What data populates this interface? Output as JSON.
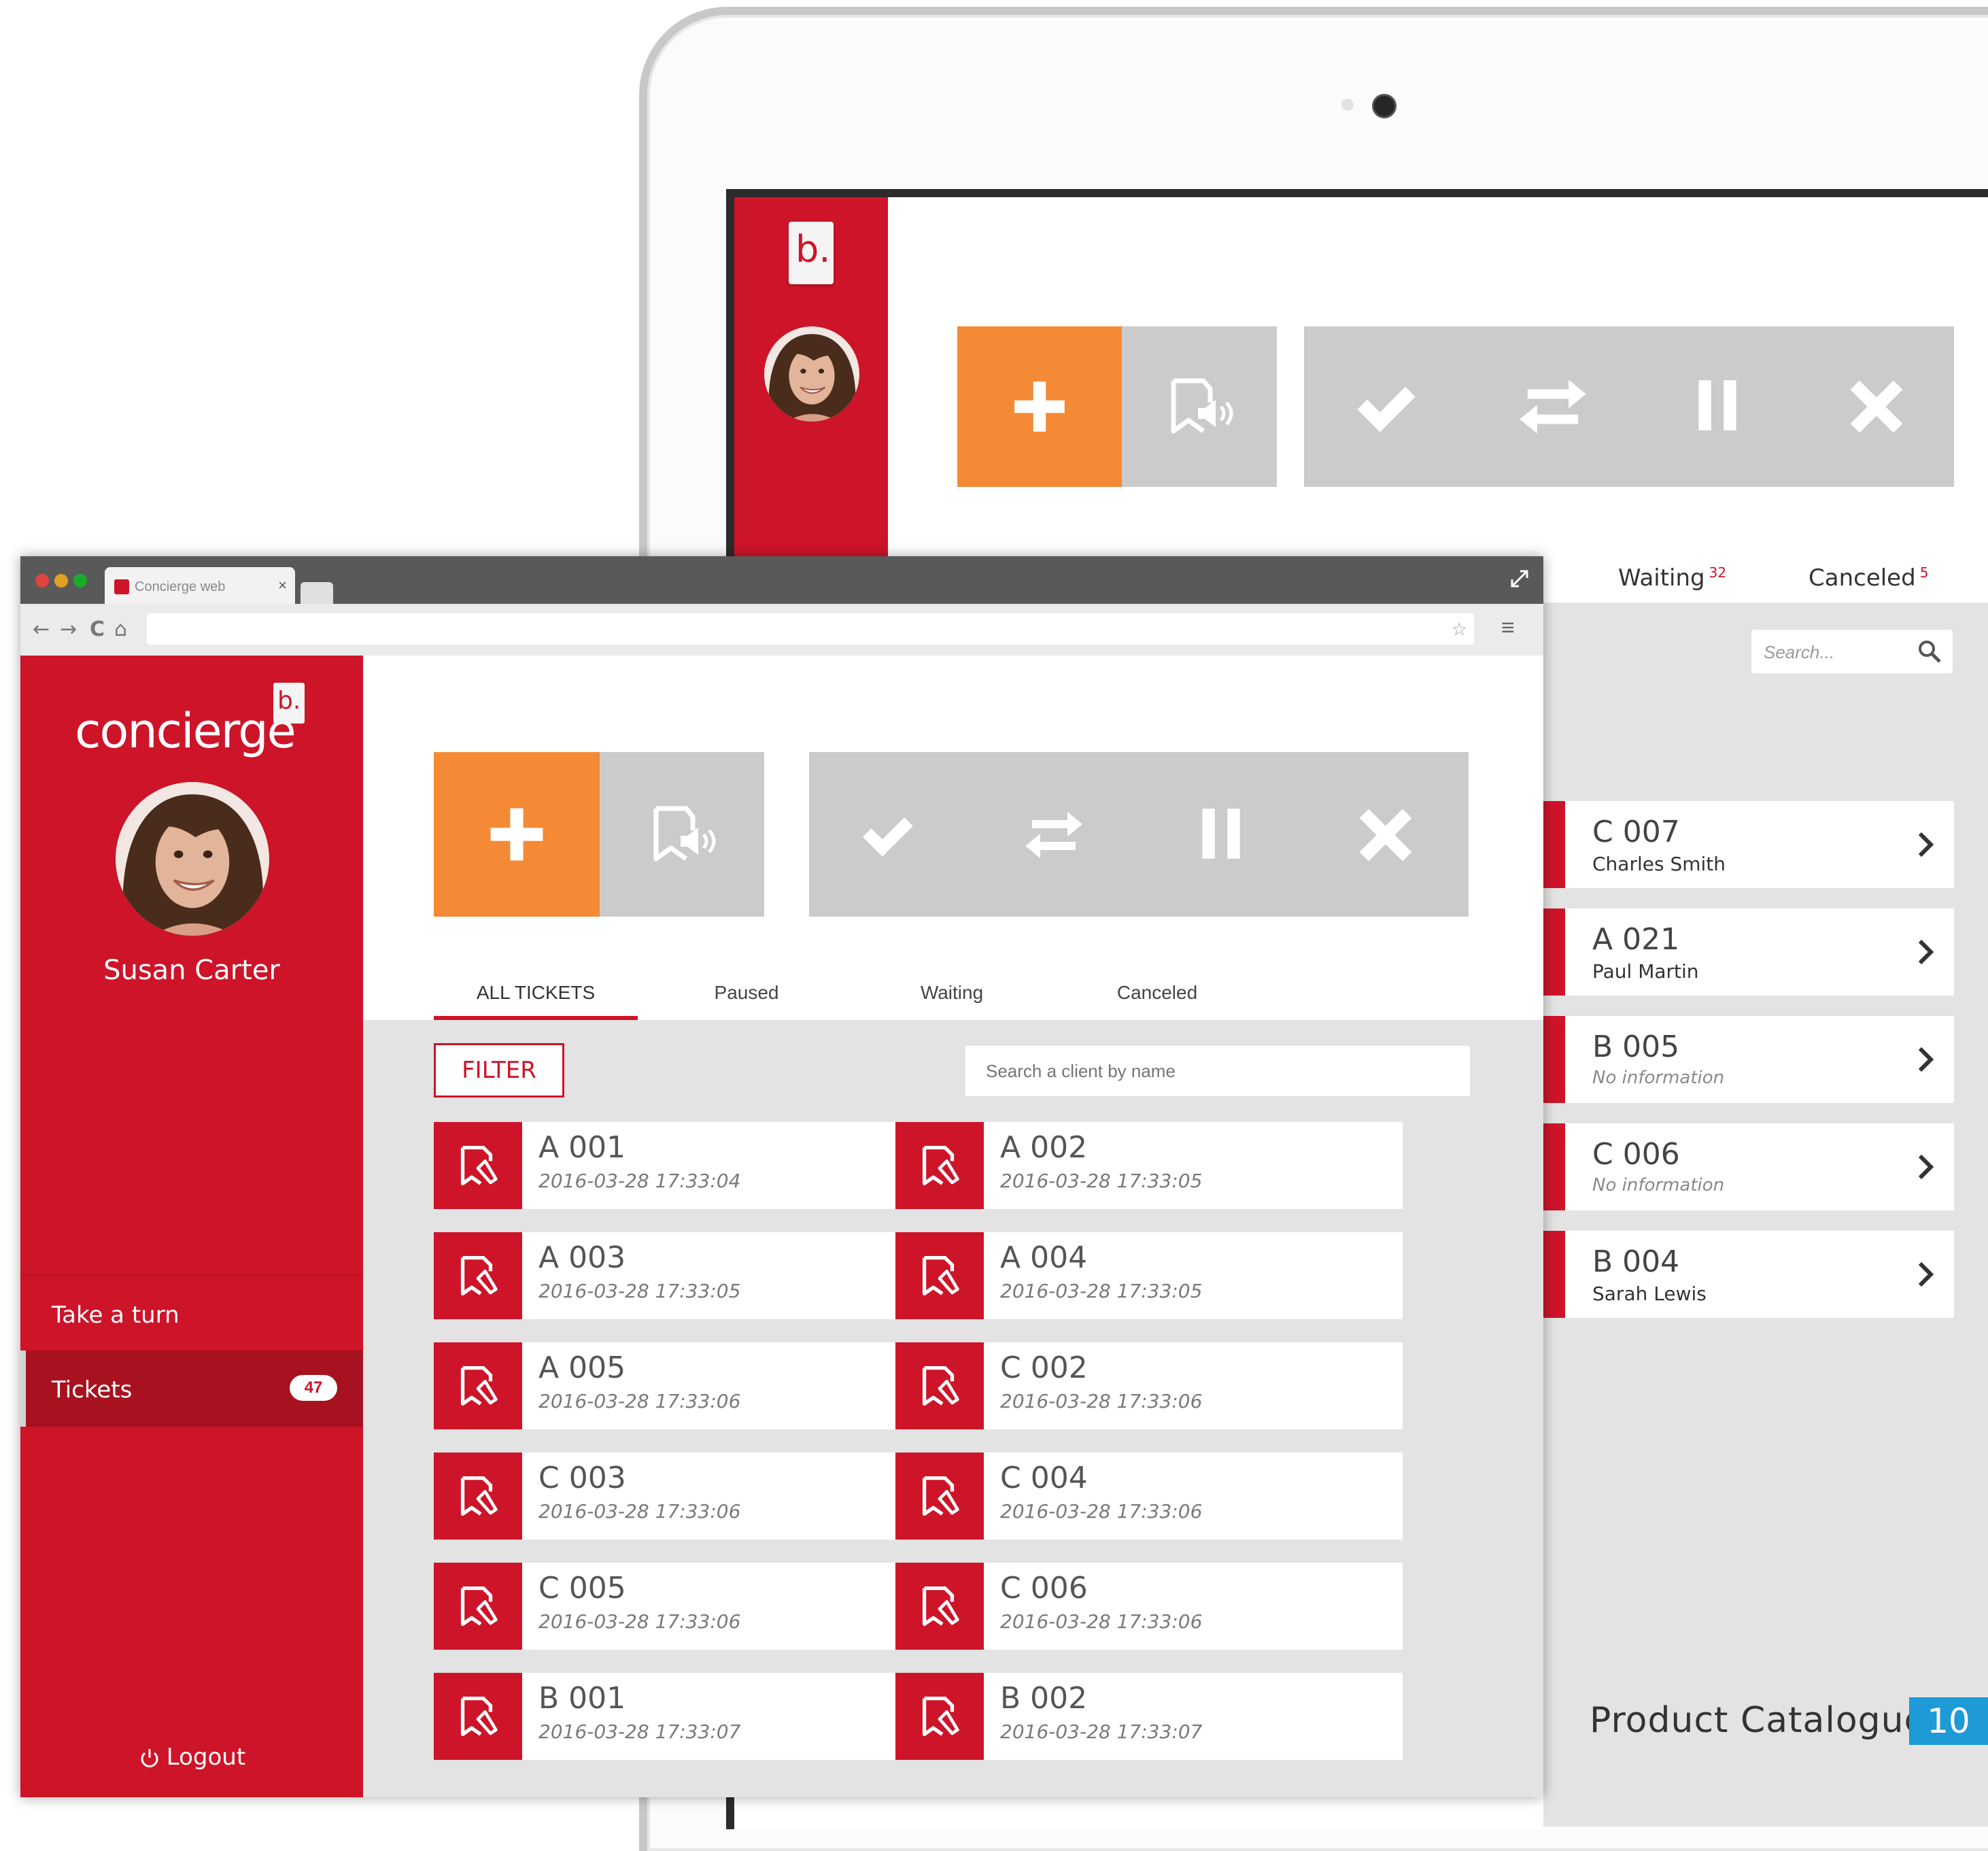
{
  "browser": {
    "tab_title": "Concierge web",
    "tab_close": "×",
    "nav": {
      "back": "←",
      "forward": "→",
      "reload": "C",
      "home": "⌂"
    },
    "bookmark_star": "☆",
    "menu": "≡"
  },
  "sidebar": {
    "brand": "concierge",
    "brand_mark": "b.",
    "user_name": "Susan Carter",
    "menu": [
      {
        "label": "Take a turn"
      },
      {
        "label": "Tickets",
        "count": "47"
      }
    ],
    "logout": "Logout"
  },
  "toolbar": {
    "icons": [
      "plus-icon",
      "call-ticket-icon",
      "check-icon",
      "transfer-icon",
      "pause-icon",
      "close-icon"
    ],
    "colors": {
      "primary": "#cd1429",
      "accent": "#f48a35",
      "inactive": "#cbcbcb"
    }
  },
  "tabs": [
    {
      "label": "ALL TICKETS",
      "active": true
    },
    {
      "label": "Paused"
    },
    {
      "label": "Waiting"
    },
    {
      "label": "Canceled"
    }
  ],
  "filter": {
    "label": "FILTER"
  },
  "client_search": {
    "placeholder": "Search a client by name"
  },
  "tickets": [
    {
      "code": "A 001",
      "time": "2016-03-28 17:33:04"
    },
    {
      "code": "A 002",
      "time": "2016-03-28 17:33:05"
    },
    {
      "code": "A 003",
      "time": "2016-03-28 17:33:05"
    },
    {
      "code": "A 004",
      "time": "2016-03-28 17:33:05"
    },
    {
      "code": "A 005",
      "time": "2016-03-28 17:33:06"
    },
    {
      "code": "C 002",
      "time": "2016-03-28 17:33:06"
    },
    {
      "code": "C 003",
      "time": "2016-03-28 17:33:06"
    },
    {
      "code": "C 004",
      "time": "2016-03-28 17:33:06"
    },
    {
      "code": "C 005",
      "time": "2016-03-28 17:33:06"
    },
    {
      "code": "C 006",
      "time": "2016-03-28 17:33:06"
    },
    {
      "code": "B 001",
      "time": "2016-03-28 17:33:07"
    },
    {
      "code": "B 002",
      "time": "2016-03-28 17:33:07"
    }
  ],
  "tablet": {
    "logo_mark": "b.",
    "tabs": [
      {
        "label": "Waiting",
        "count": "32"
      },
      {
        "label": "Canceled",
        "count": "5"
      }
    ],
    "search_placeholder": "Search...",
    "queue": [
      {
        "code": "C 007",
        "name": "Charles Smith",
        "no_info": false
      },
      {
        "code": "A 021",
        "name": "Paul Martin",
        "no_info": false
      },
      {
        "code": "B 005",
        "name": "No information",
        "no_info": true
      },
      {
        "code": "C 006",
        "name": "No information",
        "no_info": true
      },
      {
        "code": "B 004",
        "name": "Sarah Lewis",
        "no_info": false
      }
    ]
  },
  "footer": {
    "label": "Product Catalogue",
    "page": "10",
    "badge_color": "#1e9ad6"
  }
}
